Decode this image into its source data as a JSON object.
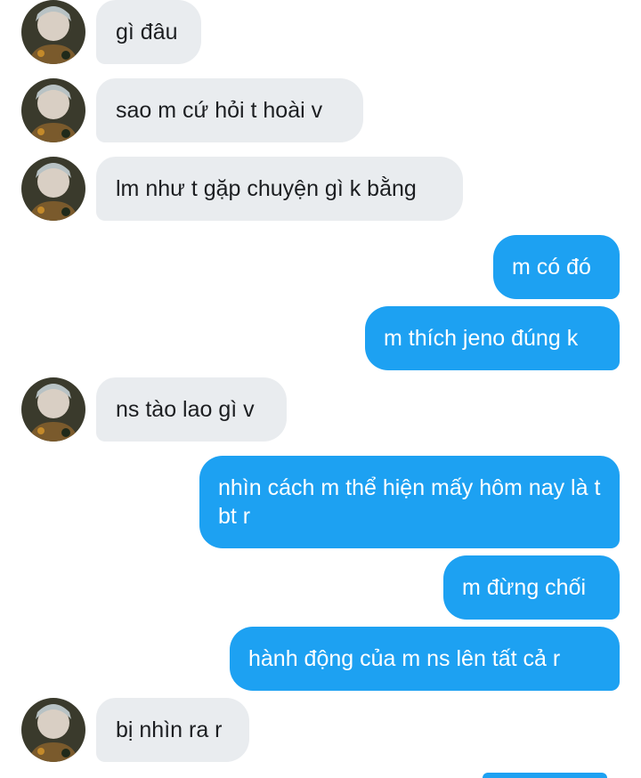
{
  "conversation": {
    "messages": [
      {
        "side": "incoming",
        "text": "gì đâu"
      },
      {
        "side": "incoming",
        "text": "sao m cứ hỏi t hoài v"
      },
      {
        "side": "incoming",
        "text": "lm như t gặp chuyện gì k bằng"
      },
      {
        "side": "outgoing",
        "text": "m có đó"
      },
      {
        "side": "outgoing",
        "text": "m thích jeno đúng k"
      },
      {
        "side": "incoming",
        "text": "ns tào lao gì v"
      },
      {
        "side": "outgoing",
        "text": "nhìn cách m thể hiện mấy hôm nay là t bt r"
      },
      {
        "side": "outgoing",
        "text": "m đừng chối"
      },
      {
        "side": "outgoing",
        "text": "hành động của m ns lên tất cả r"
      },
      {
        "side": "incoming",
        "text": "bị nhìn ra r"
      }
    ]
  },
  "colors": {
    "incoming_bubble": "#e9ecef",
    "outgoing_bubble": "#1da1f2"
  },
  "icons": {
    "avatar": "contact-avatar-icon"
  }
}
